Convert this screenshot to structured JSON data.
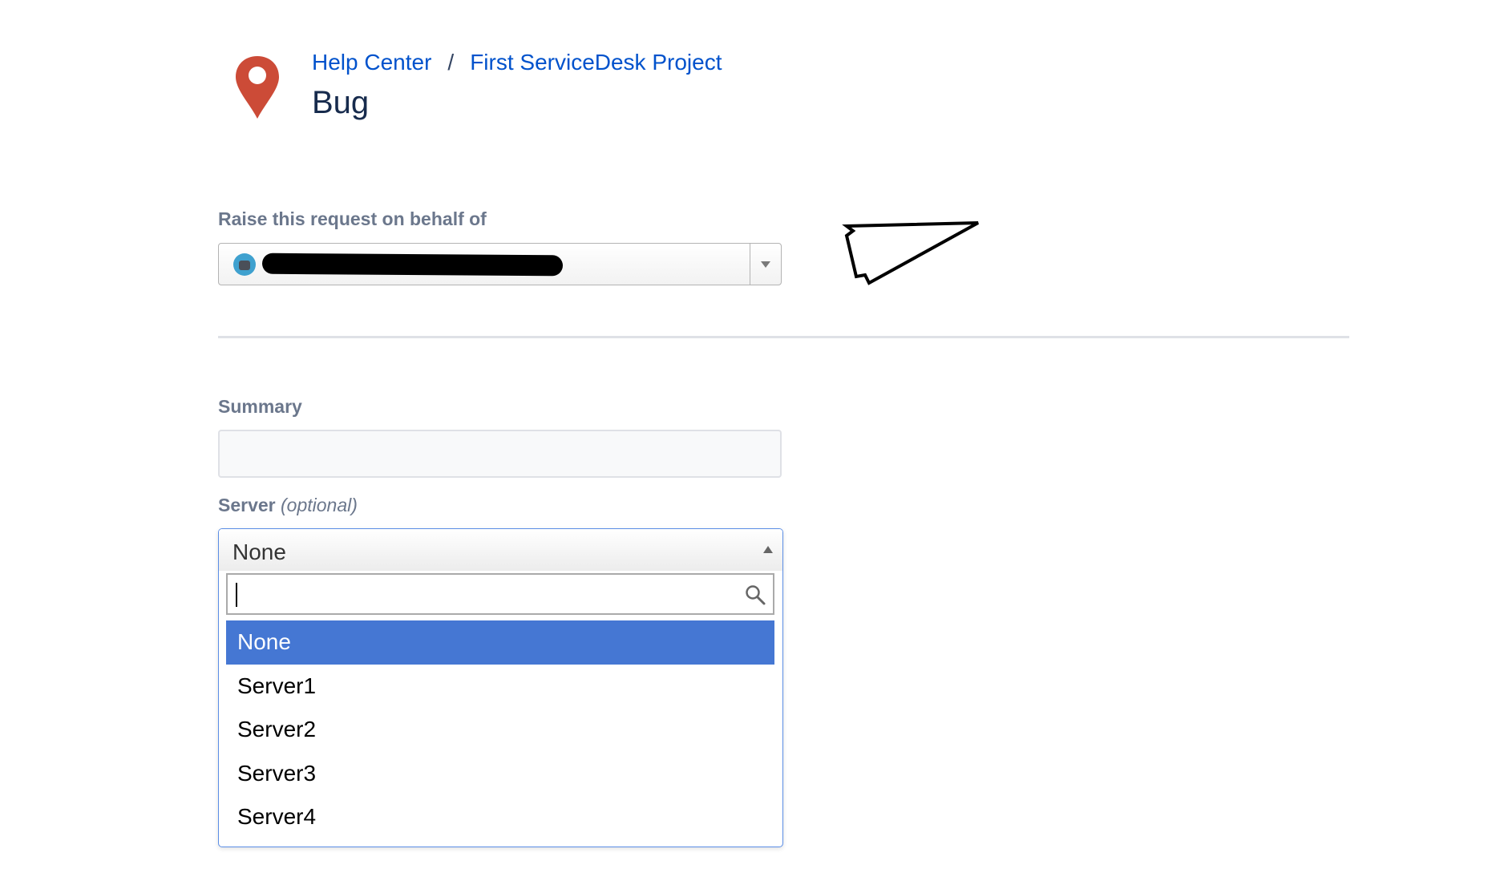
{
  "header": {
    "breadcrumb": [
      "Help Center",
      "First ServiceDesk Project"
    ],
    "separator": "/",
    "title": "Bug",
    "logo_icon": "location-pin-icon",
    "logo_color": "#cc4b37"
  },
  "form": {
    "behalf_label": "Raise this request on behalf of",
    "summary_label": "Summary",
    "summary_value": "",
    "server_label": "Server",
    "server_optional": "(optional)",
    "server_value": "None",
    "search_value": "",
    "server_options": [
      "None",
      "Server1",
      "Server2",
      "Server3",
      "Server4"
    ],
    "selected_option": "None"
  },
  "colors": {
    "link": "#0052cc",
    "highlight": "#4577d3",
    "focus_border": "#5b8ee6",
    "label": "#6b778c"
  }
}
